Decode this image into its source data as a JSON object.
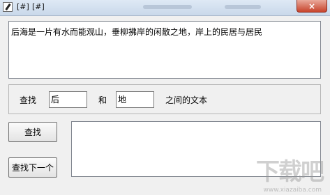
{
  "titlebar": {
    "marker1": "[#]",
    "marker2": "[#]",
    "close_glyph": "×"
  },
  "source_text": "后海是一片有水而能观山，垂柳拂岸的闲散之地，岸上的民居与居民",
  "search": {
    "find_label": "查找",
    "start_value": "后",
    "and_label": "和",
    "end_value": "地",
    "between_label": "之间的文本"
  },
  "buttons": {
    "find": "查找",
    "find_next": "查找下一个"
  },
  "result_text": "",
  "watermark": {
    "logo": "下载吧",
    "url": "www.xiazaiba.com"
  },
  "colors": {
    "window_bg": "#f0f0f0",
    "close_red": "#c7432b"
  }
}
